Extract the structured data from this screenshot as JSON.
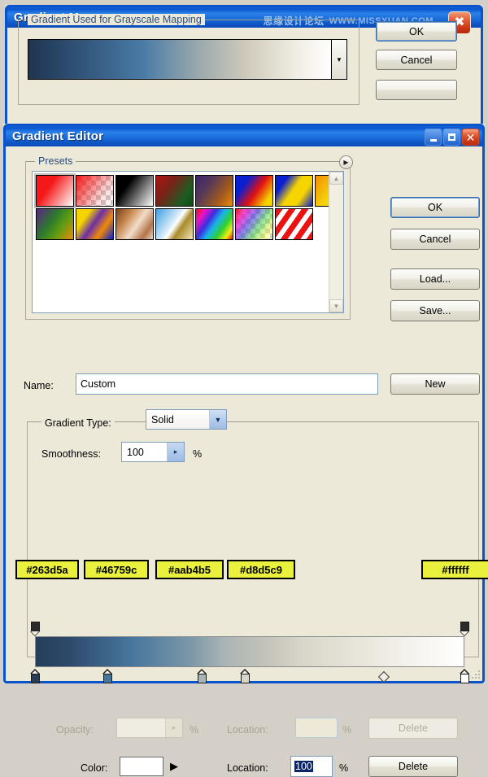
{
  "gradient_map": {
    "title": "Gradient Map",
    "group_label": "Gradient Used for Grayscale Mapping",
    "ok_label": "OK",
    "cancel_label": "Cancel",
    "dropdown_icon": "chevron-down-icon",
    "preview_gradient": "linear-gradient(90deg,#1f3550 0%,#2b4a6d 12%,#4a7ba6 38%,#9aa9ac 56%,#cfcabb 72%,#efece1 88%,#ffffff 100%)"
  },
  "watermark": {
    "chinese": "思缘设计论坛",
    "url": "WWW.MISSYUAN.COM",
    "logo_glyph": "✖"
  },
  "titlebar_buttons": {
    "minimize": "minimize-icon",
    "maximize": "maximize-icon",
    "close": "✕"
  },
  "gradient_editor": {
    "title": "Gradient Editor",
    "presets": {
      "label": "Presets",
      "menu_icon": "preset-menu-arrow-icon",
      "scroll_up_icon": "▲",
      "scroll_down_icon": "▼",
      "items": [
        {
          "name": "foreground-to-transparent-red",
          "css": "linear-gradient(125deg,#f41818 0%,#f41818 35%,#ffffff 100%)"
        },
        {
          "name": "red-transparent-checker",
          "css": "linear-gradient(125deg,#f41818 0%,rgba(244,24,24,0.15) 70%,rgba(244,24,24,0) 100%)",
          "checker": true
        },
        {
          "name": "black-to-white",
          "css": "linear-gradient(125deg,#000000 0%,#000000 30%,#ffffff 100%)"
        },
        {
          "name": "red-green",
          "css": "linear-gradient(125deg,#b01515 0%,#7a2218 35%,#1d5d21 75%,#0e4a16 100%)"
        },
        {
          "name": "violet-orange",
          "css": "linear-gradient(125deg,#3c2270 0%,#5a3a55 35%,#a35a1c 70%,#ef8b08 100%)"
        },
        {
          "name": "blue-red-yellow",
          "css": "linear-gradient(125deg,#0a1fcf 0%,#0a1fcf 25%,#e21010 55%,#f5d400 85%,#f5d400 100%)"
        },
        {
          "name": "blue-yellow-blue",
          "css": "linear-gradient(125deg,#0a1fcf 0%,#0a1fcf 22%,#f5d400 48%,#f5d400 70%,#0a1fcf 100%)"
        },
        {
          "name": "orange-yellow-orange",
          "css": "linear-gradient(125deg,#f08f06 0%,#f5cf08 45%,#f5d900 60%,#f08f06 100%)"
        },
        {
          "name": "violet-green-orange",
          "css": "linear-gradient(125deg,#5b2287 0%,#2c7a2c 40%,#5f9c12 65%,#ef8b08 100%)"
        },
        {
          "name": "yellow-violet-orange-blue",
          "css": "linear-gradient(125deg,#f5d400 0%,#f5d400 25%,#6b2fa8 48%,#ef8b08 70%,#0a1fcf 100%)"
        },
        {
          "name": "copper",
          "css": "linear-gradient(125deg,#7a4118 0%,#c98a52 30%,#f2ddc9 55%,#b3754a 80%,#e9d6c3 100%)"
        },
        {
          "name": "chrome",
          "css": "linear-gradient(125deg,#3e9fe0 0%,#d8ecfa 45%,#ffffff 52%,#a98b2a 66%,#f3e6bb 100%)"
        },
        {
          "name": "spectrum",
          "css": "linear-gradient(125deg,#ee1111 0%,#ee11c8 18%,#3a2ee0 36%,#18b6e8 52%,#2fd02f 70%,#f0f014 86%,#ee1111 100%)"
        },
        {
          "name": "transparent-rainbow",
          "css": "linear-gradient(125deg,rgba(238,17,17,0.9) 0%,rgba(238,17,200,0.75) 20%,rgba(58,46,224,0.6) 40%,rgba(47,208,47,0.5) 62%,rgba(240,240,20,0.4) 82%,rgba(255,255,255,0) 100%)",
          "checker": true
        },
        {
          "name": "red-stripes",
          "css": "repeating-linear-gradient(125deg,#ee1111 0 7px,#ffffff 7px 13px)",
          "checker": true
        }
      ]
    },
    "buttons": {
      "ok": "OK",
      "cancel": "Cancel",
      "load": "Load...",
      "save": "Save...",
      "new": "New"
    },
    "name_field": {
      "label": "Name:",
      "value": "Custom"
    },
    "gradient_type": {
      "label": "Gradient Type:",
      "value": "Solid",
      "chevron": "chevron-down-icon"
    },
    "smoothness": {
      "label": "Smoothness:",
      "value": "100",
      "unit": "%",
      "arrow": "▸"
    },
    "gradient_bar": {
      "css": "linear-gradient(90deg,#263d5a 0%,#2e4a6c 8%,#46759c 22%,#7a97a8 36%,#aab4b5 44%,#c4c3b9 54%,#d8d5c9 62%,#e6e3d8 74%,#f3f1ea 86%,#ffffff 100%)",
      "color_stops": [
        {
          "hex": "#263d5a",
          "location": 0
        },
        {
          "hex": "#46759c",
          "location": 17
        },
        {
          "hex": "#aab4b5",
          "location": 39
        },
        {
          "hex": "#d8d5c9",
          "location": 49
        },
        {
          "hex": "#ffffff",
          "location": 100
        }
      ],
      "opacity_stops": [
        {
          "location": 0
        },
        {
          "location": 100
        }
      ],
      "midpoint_location": 81
    },
    "opacity_row": {
      "label": "Opacity:",
      "value": "",
      "unit": "%",
      "arrow": "▸",
      "location_label": "Location:",
      "location_value": "",
      "location_unit": "%",
      "delete_label": "Delete",
      "enabled": false
    },
    "color_row": {
      "label": "Color:",
      "swatch_hex": "#ffffff",
      "arrow": "▶",
      "location_label": "Location:",
      "location_value": "100",
      "location_unit": "%",
      "delete_label": "Delete",
      "enabled": true
    }
  }
}
